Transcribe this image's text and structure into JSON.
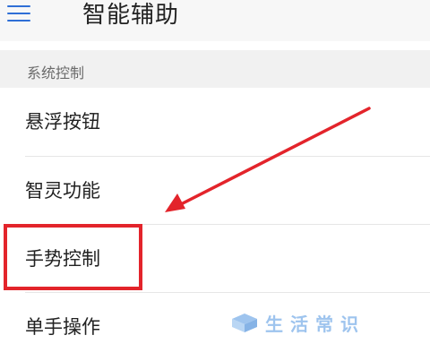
{
  "header": {
    "title": "智能辅助"
  },
  "section": {
    "label": "系统控制"
  },
  "items": [
    {
      "label": "悬浮按钮"
    },
    {
      "label": "智灵功能"
    },
    {
      "label": "手势控制"
    },
    {
      "label": "单手操作"
    }
  ],
  "annotation": {
    "arrow_color": "#e3242b",
    "highlight_color": "#e3242b",
    "highlighted_item": "手势控制"
  },
  "watermark": {
    "text": "生活常识",
    "color": "#9ec4ee"
  },
  "colors": {
    "accent": "#2f6fd6",
    "background": "#ffffff",
    "section_background": "#f1f1f1"
  }
}
